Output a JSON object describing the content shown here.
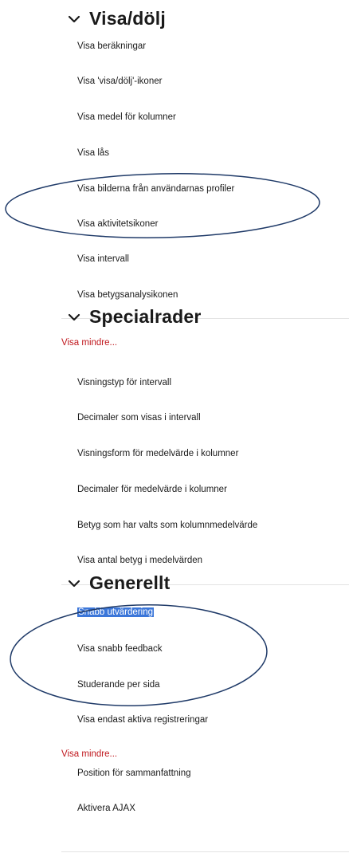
{
  "sections": [
    {
      "title": "Visa/dölj",
      "chevron_icon": "chevron-down-icon",
      "items": [
        "Visa beräkningar",
        "Visa 'visa/dölj'-ikoner",
        "Visa medel för kolumner",
        "Visa lås",
        "Visa bilderna från användarnas profiler",
        "Visa aktivitetsikoner",
        "Visa intervall",
        "Visa betygsanalysikonen"
      ]
    },
    {
      "title": "Specialrader",
      "chevron_icon": "chevron-down-icon",
      "show_less": "Visa mindre...",
      "items": [
        "Visningstyp för intervall",
        "Decimaler som visas i intervall",
        "Visningsform för medelvärde i kolumner",
        "Decimaler för medelvärde i kolumner",
        "Betyg som har valts som kolumnmedelvärde",
        "Visa antal betyg i medelvärden"
      ]
    },
    {
      "title": "Generellt",
      "chevron_icon": "chevron-down-icon",
      "items": [
        "Snabb utvärdering",
        "Visa snabb feedback",
        "Studerande per sida",
        "Visa endast aktiva registreringar"
      ],
      "show_less": "Visa mindre...",
      "more_items": [
        "Position för sammanfattning",
        "Aktivera AJAX"
      ]
    }
  ],
  "colors": {
    "text": "#1a1a1a",
    "link_red": "#c0181e",
    "selection_blue": "#3b76d9",
    "annotation_ellipse": "#1f3a68",
    "divider": "#e3e3e3"
  }
}
